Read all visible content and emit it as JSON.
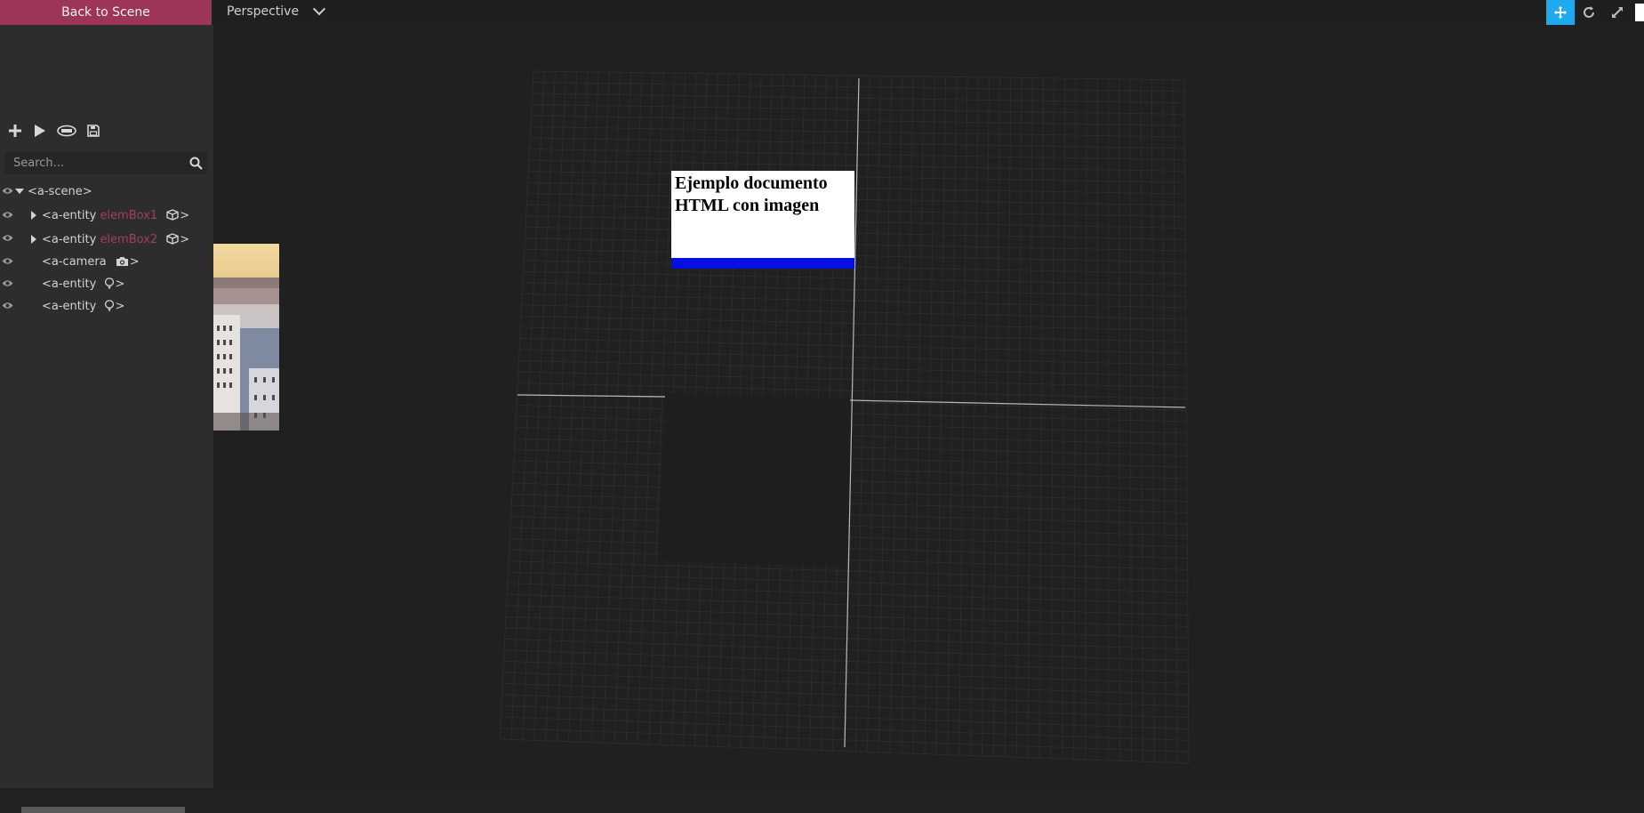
{
  "topbar": {
    "back_label": "Back to Scene",
    "camera_label": "Perspective"
  },
  "toolbar": {
    "icons": [
      "plus-icon",
      "play-icon",
      "gltf-icon",
      "save-icon"
    ]
  },
  "search": {
    "placeholder": "Search..."
  },
  "tree": {
    "scene": "<a-scene>",
    "entity_prefix": "<a-entity",
    "camera_prefix": "<a-camera",
    "close": ">",
    "items": [
      {
        "id": "elemBox1"
      },
      {
        "id": "elemBox2"
      }
    ]
  },
  "viewport": {
    "document_text": "Ejemplo documento HTML con imagen"
  },
  "colors": {
    "accent": "#9c3556",
    "active_tool": "#1faaf0",
    "entity_id": "#a1405e",
    "box_edge": "#0010e0"
  }
}
